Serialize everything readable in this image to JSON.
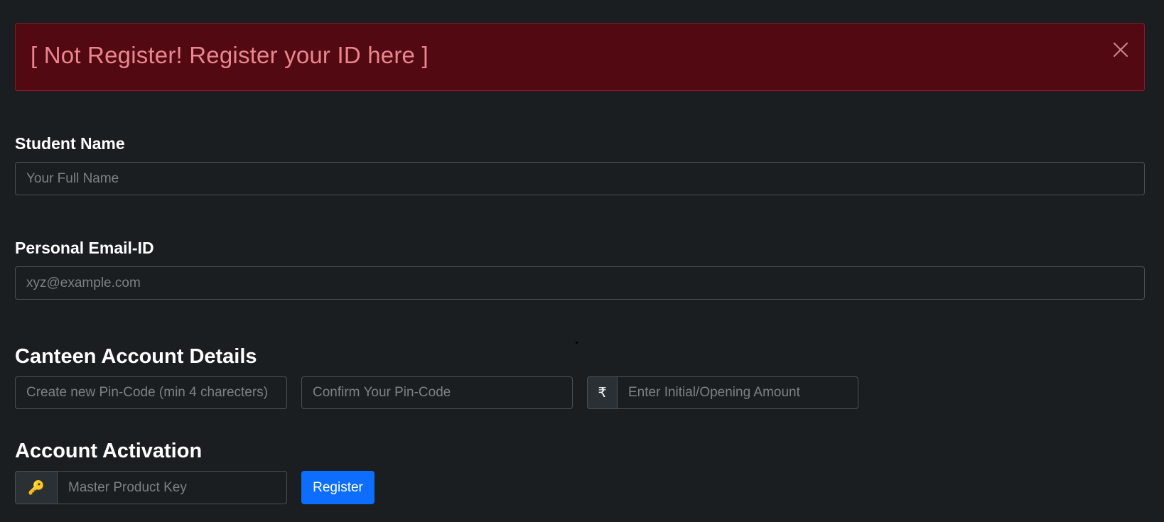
{
  "alert": {
    "message": "[ Not Register! Register your ID here ]",
    "close_icon": "close-icon"
  },
  "student_name": {
    "label": "Student Name",
    "placeholder": "Your Full Name",
    "value": ""
  },
  "email": {
    "label": "Personal Email-ID",
    "placeholder": "xyz@example.com",
    "value": ""
  },
  "canteen": {
    "title": "Canteen Account Details",
    "pin_placeholder": "Create new Pin-Code (min 4 charecters)",
    "confirm_placeholder": "Confirm Your Pin-Code",
    "currency_symbol": "₹",
    "amount_placeholder": "Enter Initial/Opening Amount"
  },
  "activation": {
    "title": "Account Activation",
    "key_icon": "🔑",
    "key_placeholder": "Master Product Key",
    "register_label": "Register"
  },
  "colors": {
    "background": "#1b1e20",
    "alert_bg": "#520911",
    "alert_text": "#ea868f",
    "primary": "#0d6efd"
  }
}
